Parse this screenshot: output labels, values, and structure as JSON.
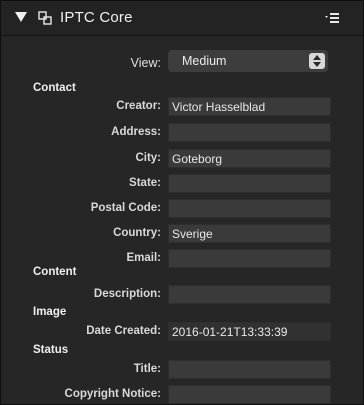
{
  "header": {
    "title": "IPTC Core"
  },
  "view": {
    "label": "View:",
    "value": "Medium"
  },
  "sections": {
    "contact": "Contact",
    "content": "Content",
    "image": "Image",
    "status": "Status"
  },
  "fields": {
    "creator": {
      "label": "Creator:",
      "value": "Victor Hasselblad"
    },
    "address": {
      "label": "Address:",
      "value": ""
    },
    "city": {
      "label": "City:",
      "value": "Goteborg"
    },
    "state": {
      "label": "State:",
      "value": ""
    },
    "postal_code": {
      "label": "Postal Code:",
      "value": ""
    },
    "country": {
      "label": "Country:",
      "value": "Sverige"
    },
    "email": {
      "label": "Email:",
      "value": ""
    },
    "description": {
      "label": "Description:",
      "value": ""
    },
    "date_created": {
      "label": "Date Created:",
      "value": "2016-01-21T13:33:39"
    },
    "title": {
      "label": "Title:",
      "value": ""
    },
    "copyright_notice": {
      "label": "Copyright Notice:",
      "value": ""
    }
  },
  "icons": {
    "disclosure": "disclosure-triangle-icon",
    "link": "linked-frames-icon",
    "menu": "panel-menu-icon"
  }
}
